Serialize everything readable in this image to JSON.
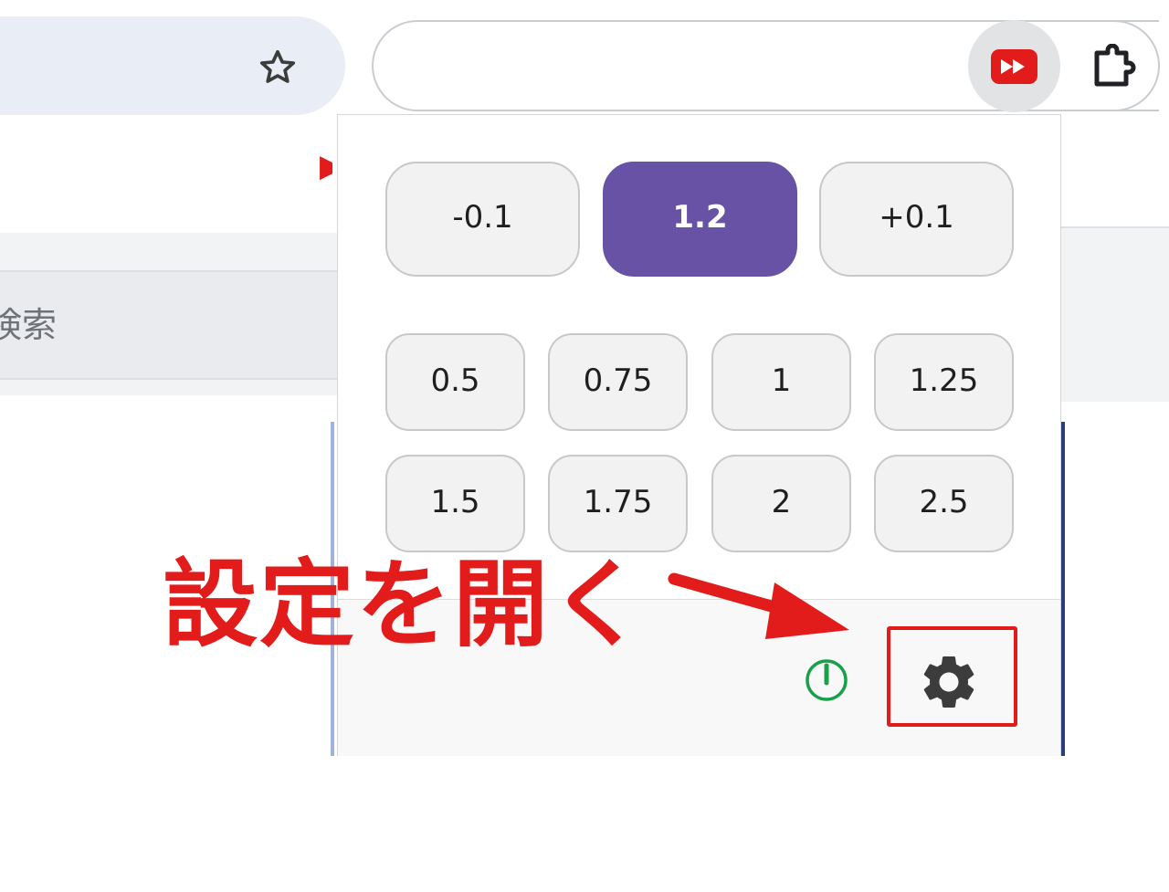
{
  "browser": {
    "search_placeholder": "検索"
  },
  "popup": {
    "step_buttons": [
      "-0.1",
      "1.2",
      "+0.1"
    ],
    "current_speed": "1.2",
    "preset_speeds": [
      "0.5",
      "0.75",
      "1",
      "1.25",
      "1.5",
      "1.75",
      "2",
      "2.5"
    ]
  },
  "annotation": {
    "label": "設定を開く",
    "color": "#e21b1b"
  },
  "colors": {
    "accent": "#6752a6",
    "power_on": "#1aa04a",
    "extension_brand": "#e21b1b"
  },
  "icons": {
    "toolbar": [
      "star-icon",
      "speed-extension-icon",
      "puzzle-icon"
    ],
    "footer": [
      "power-icon",
      "gear-icon"
    ]
  }
}
